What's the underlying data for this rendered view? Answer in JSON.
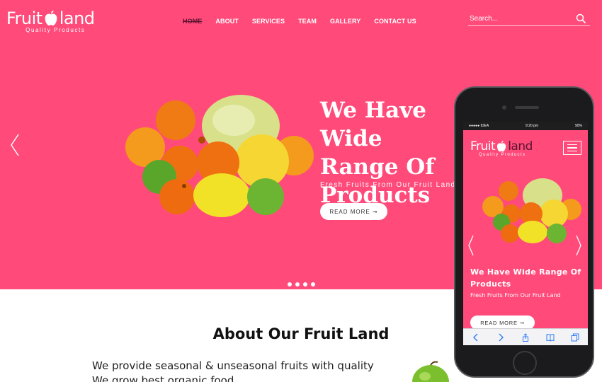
{
  "brand": {
    "name_left": "Fruit",
    "name_right": "land",
    "tagline": "Quality Products"
  },
  "nav": [
    {
      "label": "HOME",
      "active": true
    },
    {
      "label": "ABOUT"
    },
    {
      "label": "SERVICES"
    },
    {
      "label": "TEAM"
    },
    {
      "label": "GALLERY"
    },
    {
      "label": "CONTACT US"
    }
  ],
  "search": {
    "placeholder": "Search..."
  },
  "hero": {
    "title": "We Have Wide\nRange Of\nProducts",
    "subtitle": "Fresh Fruits From Our Fruit Land",
    "cta_label": "READ MORE ➞",
    "slide_dots": 4
  },
  "about": {
    "title": "About Our Fruit Land",
    "text_lines": [
      "We provide seasonal & unseasonal fruits with quality",
      "We grow best organic food"
    ]
  },
  "mobile": {
    "status": {
      "carrier": "●●●●● IDEA",
      "time": "9:20 pm",
      "battery": "90%"
    },
    "brand_left": "Fruit",
    "brand_right": "land",
    "tagline": "Quality Products",
    "title": "We Have Wide Range Of Products",
    "subtitle": "Fresh Fruits From Our Fruit Land",
    "cta_label": "READ MORE ➞"
  },
  "colors": {
    "hero_bg": "#ff4a7a",
    "active_nav": "#5a1530"
  }
}
